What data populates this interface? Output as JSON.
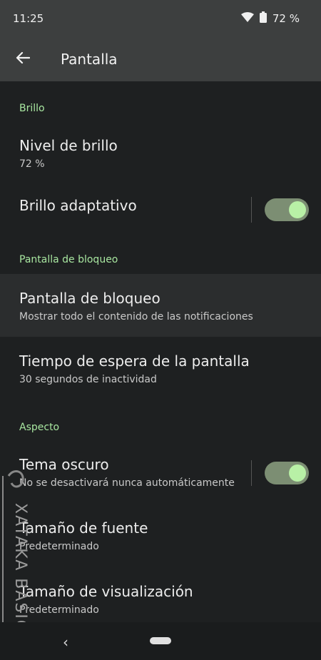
{
  "status_bar": {
    "time": "11:25",
    "battery_percent": "72 %",
    "icons": [
      "wifi-icon",
      "battery-icon"
    ]
  },
  "app_bar": {
    "back_icon": "arrow-back-icon",
    "title": "Pantalla"
  },
  "sections": {
    "brillo": {
      "header": "Brillo",
      "nivel": {
        "title": "Nivel de brillo",
        "subtitle": "72 %"
      },
      "adaptativo": {
        "title": "Brillo adaptativo",
        "enabled": true
      }
    },
    "bloqueo": {
      "header": "Pantalla de bloqueo",
      "pantalla": {
        "title": "Pantalla de bloqueo",
        "subtitle": "Mostrar todo el contenido de las notificaciones"
      },
      "tiempo": {
        "title": "Tiempo de espera de la pantalla",
        "subtitle": "30 segundos de inactividad"
      }
    },
    "aspecto": {
      "header": "Aspecto",
      "tema": {
        "title": "Tema oscuro",
        "subtitle": "No se desactivará nunca automáticamente",
        "enabled": true
      },
      "fuente": {
        "title": "Tamaño de fuente",
        "subtitle": "Predeterminado"
      },
      "visualizacion": {
        "title": "Tamaño de visualización",
        "subtitle": "Predeterminado"
      }
    }
  },
  "nav_bar": {
    "back_icon": "chevron-left-icon",
    "home_icon": "home-pill-icon"
  },
  "watermark": {
    "text": "XATAKA BASICS"
  },
  "colors": {
    "accent_green": "#a8e6a0",
    "toggle_track": "#7c8e73",
    "toggle_knob": "#b8f0a6",
    "background": "#1e2021",
    "app_bar": "#3d3f3f"
  }
}
